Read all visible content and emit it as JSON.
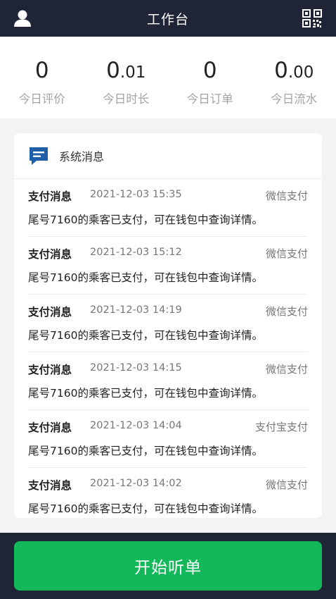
{
  "header": {
    "title": "工作台",
    "user_icon": "user-icon",
    "qr_icon": "qr-code-icon"
  },
  "stats": [
    {
      "int": "0",
      "dec": "",
      "label": "今日评价"
    },
    {
      "int": "0",
      "dec": ".01",
      "label": "今日时长"
    },
    {
      "int": "0",
      "dec": "",
      "label": "今日订单"
    },
    {
      "int": "0",
      "dec": ".00",
      "label": "今日流水"
    }
  ],
  "messages": {
    "title": "系统消息",
    "icon": "message-icon",
    "items": [
      {
        "title": "支付消息",
        "time": "2021-12-03 15:35",
        "pay": "微信支付",
        "text": "尾号7160的乘客已支付，可在钱包中查询详情。"
      },
      {
        "title": "支付消息",
        "time": "2021-12-03 15:12",
        "pay": "微信支付",
        "text": "尾号7160的乘客已支付，可在钱包中查询详情。"
      },
      {
        "title": "支付消息",
        "time": "2021-12-03 14:19",
        "pay": "微信支付",
        "text": "尾号7160的乘客已支付，可在钱包中查询详情。"
      },
      {
        "title": "支付消息",
        "time": "2021-12-03 14:15",
        "pay": "微信支付",
        "text": "尾号7160的乘客已支付，可在钱包中查询详情。"
      },
      {
        "title": "支付消息",
        "time": "2021-12-03 14:04",
        "pay": "支付宝支付",
        "text": "尾号7160的乘客已支付，可在钱包中查询详情。"
      },
      {
        "title": "支付消息",
        "time": "2021-12-03 14:02",
        "pay": "微信支付",
        "text": "尾号7160的乘客已支付，可在钱包中查询详情。"
      }
    ]
  },
  "footer": {
    "start_label": "开始听单"
  },
  "colors": {
    "nav": "#1f2436",
    "accent": "#12b85a",
    "icon_blue": "#1f5fa8"
  }
}
